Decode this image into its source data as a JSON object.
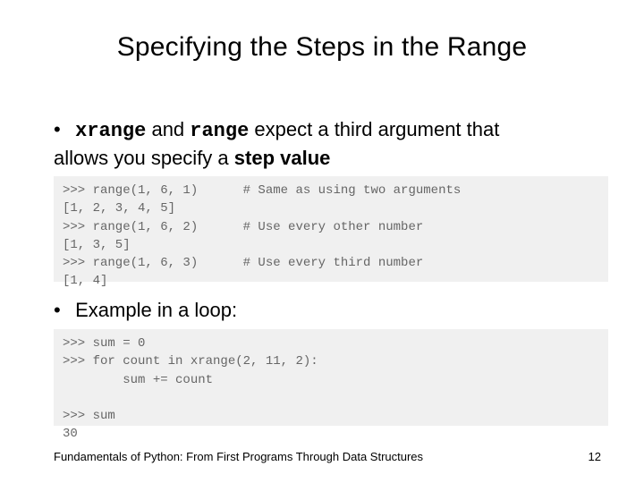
{
  "title": "Specifying the Steps in the Range",
  "bullet1": {
    "lead": "xrange",
    "mid": " and ",
    "second": "range",
    "rest1": " expect a third argument that",
    "line2a": "allows you specify a ",
    "strong": "step value"
  },
  "code1": ">>> range(1, 6, 1)      # Same as using two arguments\n[1, 2, 3, 4, 5]\n>>> range(1, 6, 2)      # Use every other number\n[1, 3, 5]\n>>> range(1, 6, 3)      # Use every third number\n[1, 4]",
  "bullet2": "Example in a loop:",
  "code2": ">>> sum = 0\n>>> for count in xrange(2, 11, 2):\n        sum += count\n\n>>> sum\n30",
  "footer": "Fundamentals of Python: From First Programs Through Data Structures",
  "page": "12"
}
